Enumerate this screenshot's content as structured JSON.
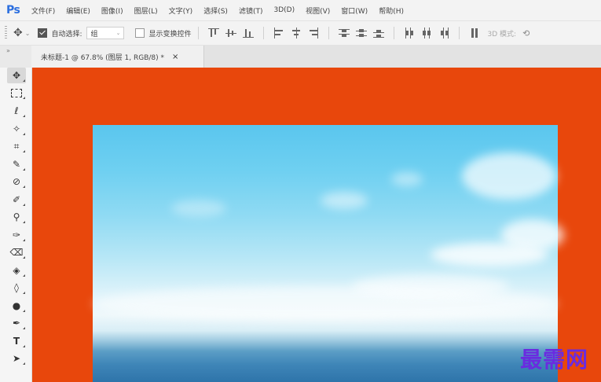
{
  "app": {
    "logo": "Ps"
  },
  "menu": [
    "文件(F)",
    "编辑(E)",
    "图像(I)",
    "图层(L)",
    "文字(Y)",
    "选择(S)",
    "滤镜(T)",
    "3D(D)",
    "视图(V)",
    "窗口(W)",
    "帮助(H)"
  ],
  "options": {
    "move_icon": "move-icon",
    "auto_select_label": "自动选择:",
    "auto_select_checked": true,
    "auto_select_value": "组",
    "show_transform_label": "显示变换控件",
    "show_transform_checked": false,
    "mode_3d_label": "3D 模式:"
  },
  "document_tab": {
    "title": "未标题-1 @ 67.8% (图层 1, RGB/8) *",
    "close": "×"
  },
  "tools": [
    {
      "name": "move-tool",
      "icon": "move-icon",
      "glyph": "✥"
    },
    {
      "name": "marquee-tool",
      "icon": "rect-marquee-icon",
      "glyph": "⬚"
    },
    {
      "name": "lasso-tool",
      "icon": "lasso-icon",
      "glyph": "ℓ"
    },
    {
      "name": "magic-wand-tool",
      "icon": "magic-wand-icon",
      "glyph": "✧"
    },
    {
      "name": "crop-tool",
      "icon": "crop-icon",
      "glyph": "⌗"
    },
    {
      "name": "eyedropper-tool",
      "icon": "eyedropper-icon",
      "glyph": "✎"
    },
    {
      "name": "healing-brush-tool",
      "icon": "bandage-icon",
      "glyph": "⊘"
    },
    {
      "name": "brush-tool",
      "icon": "brush-icon",
      "glyph": "✐"
    },
    {
      "name": "clone-stamp-tool",
      "icon": "stamp-icon",
      "glyph": "⚲"
    },
    {
      "name": "history-brush-tool",
      "icon": "history-brush-icon",
      "glyph": "✑"
    },
    {
      "name": "eraser-tool",
      "icon": "eraser-icon",
      "glyph": "⌫"
    },
    {
      "name": "paint-bucket-tool",
      "icon": "bucket-icon",
      "glyph": "◈"
    },
    {
      "name": "blur-tool",
      "icon": "drop-icon",
      "glyph": "◊"
    },
    {
      "name": "dodge-tool",
      "icon": "dodge-icon",
      "glyph": "●"
    },
    {
      "name": "pen-tool",
      "icon": "pen-icon",
      "glyph": "✒"
    },
    {
      "name": "type-tool",
      "icon": "type-icon",
      "glyph": "T"
    },
    {
      "name": "path-selection-tool",
      "icon": "arrow-icon",
      "glyph": "➤"
    }
  ],
  "watermark": "最需网",
  "colors": {
    "canvas_bg": "#e8470c",
    "ps_blue": "#2c6fdf",
    "watermark": "#6a2be0"
  }
}
